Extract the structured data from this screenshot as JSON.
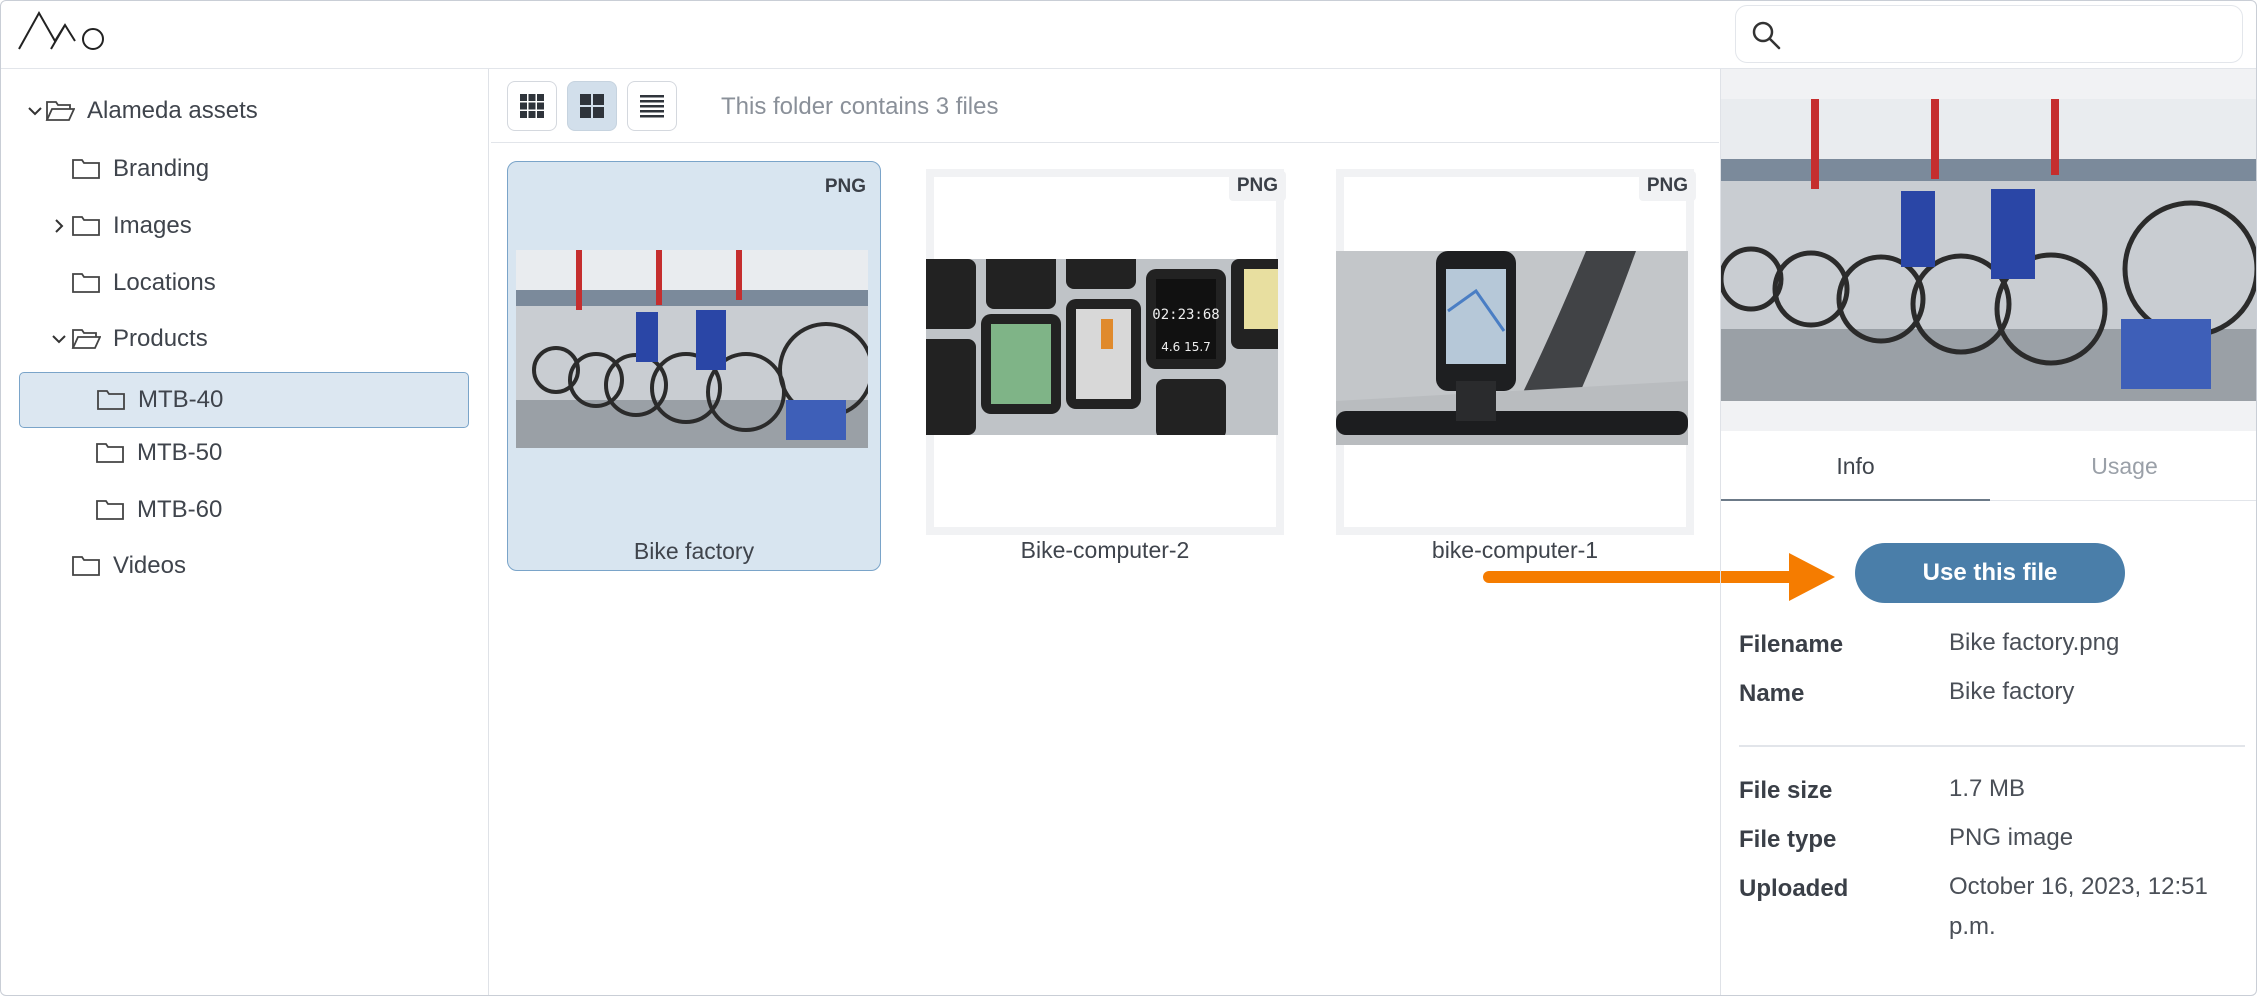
{
  "sidebar": {
    "items": [
      {
        "label": "Alameda assets"
      },
      {
        "label": "Branding"
      },
      {
        "label": "Images"
      },
      {
        "label": "Locations"
      },
      {
        "label": "Products"
      },
      {
        "label": "MTB-40"
      },
      {
        "label": "MTB-50"
      },
      {
        "label": "MTB-60"
      },
      {
        "label": "Videos"
      }
    ]
  },
  "toolbar": {
    "folder_info": "This folder contains 3 files"
  },
  "files": [
    {
      "name": "Bike factory",
      "badge": "PNG"
    },
    {
      "name": "Bike-computer-2",
      "badge": "PNG"
    },
    {
      "name": "bike-computer-1",
      "badge": "PNG"
    }
  ],
  "panel": {
    "tabs": [
      "Info",
      "Usage"
    ],
    "use_button": "Use this file",
    "meta": [
      {
        "label": "Filename",
        "value": "Bike factory.png"
      },
      {
        "label": "Name",
        "value": "Bike factory"
      },
      {
        "label": "File size",
        "value": "1.7 MB"
      },
      {
        "label": "File type",
        "value": "PNG image"
      },
      {
        "label": "Uploaded",
        "value": "October 16, 2023, 12:51 p.m."
      }
    ]
  },
  "colors": {
    "accent": "#4a7ea9",
    "selection": "#d8e5f0",
    "arrow": "#f57c00"
  }
}
